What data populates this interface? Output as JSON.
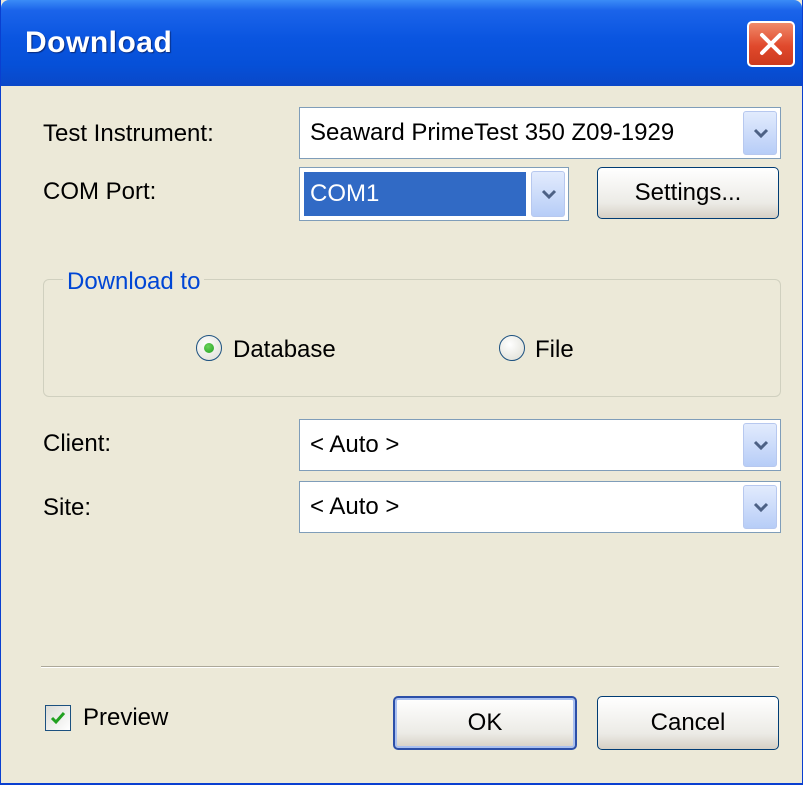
{
  "window": {
    "title": "Download"
  },
  "form": {
    "test_instrument_label": "Test Instrument:",
    "test_instrument_value": "Seaward PrimeTest 350 Z09-1929",
    "com_port_label": "COM Port:",
    "com_port_value": "COM1",
    "settings_button": "Settings...",
    "client_label": "Client:",
    "client_value": "< Auto >",
    "site_label": "Site:",
    "site_value": "< Auto >"
  },
  "download_to": {
    "legend": "Download to",
    "options": [
      {
        "label": "Database",
        "selected": true
      },
      {
        "label": "File",
        "selected": false
      }
    ]
  },
  "footer": {
    "preview_label": "Preview",
    "preview_checked": true,
    "ok_button": "OK",
    "cancel_button": "Cancel"
  },
  "colors": {
    "titlebar": "#0a55e0",
    "dialog_bg": "#ece9d8",
    "selection": "#316ac5",
    "group_legend": "#0046d5",
    "close_button": "#e0492c"
  },
  "icons": {
    "close": "close-x-icon",
    "dropdown": "chevron-down-icon",
    "check": "checkmark-icon"
  }
}
